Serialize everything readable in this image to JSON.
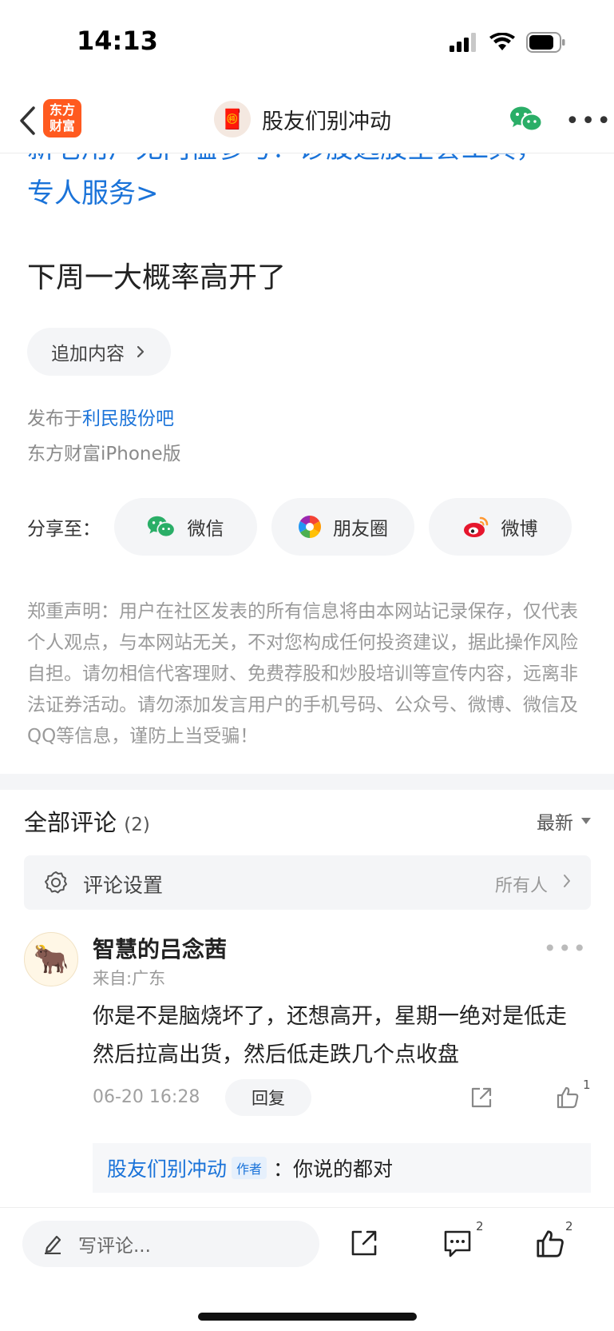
{
  "status_bar": {
    "time": "14:13",
    "battery_icon": "battery-icon",
    "wifi_icon": "wifi-icon",
    "signal_icon": "signal-icon"
  },
  "nav": {
    "app_logo": "东方\n财富",
    "title": "股友们别冲动"
  },
  "post": {
    "promo_line1": "新老用户无门槛参与！诊股选股全套工具，",
    "promo_line2": "专人服务>",
    "title": "下周一大概率高开了",
    "append_button": "追加内容",
    "published_prefix": "发布于",
    "published_bar": "利民股份吧",
    "client": "东方财富iPhone版"
  },
  "share": {
    "label": "分享至：",
    "options": [
      {
        "label": "微信",
        "icon": "wechat-icon"
      },
      {
        "label": "朋友圈",
        "icon": "moments-icon"
      },
      {
        "label": "微博",
        "icon": "weibo-icon"
      }
    ]
  },
  "disclaimer": "郑重声明：用户在社区发表的所有信息将由本网站记录保存，仅代表个人观点，与本网站无关，不对您构成任何投资建议，据此操作风险自担。请勿相信代客理财、免费荐股和炒股培训等宣传内容，远离非法证券活动。请勿添加发言用户的手机号码、公众号、微博、微信及QQ等信息，谨防上当受骗！",
  "comments": {
    "title": "全部评论",
    "count": "(2)",
    "sort": "最新",
    "settings_label": "评论设置",
    "settings_value": "所有人",
    "items": [
      {
        "name": "智慧的吕念茜",
        "location": "来自:广东",
        "text": "你是不是脑烧坏了，还想高开，星期一绝对是低走然后拉高出货，然后低走跌几个点收盘",
        "time": "06-20 16:28",
        "reply_button": "回复",
        "likes": "1",
        "reply": {
          "name": "股友们别冲动",
          "badge": "作者",
          "separator": "：",
          "text": "你说的都对"
        }
      }
    ]
  },
  "bottom_bar": {
    "placeholder": "写评论...",
    "comment_count": "2",
    "like_count": "2"
  },
  "colors": {
    "link_blue": "#1a73d9",
    "brand_orange": "#ff5a1f",
    "wechat_green": "#2aae67"
  }
}
